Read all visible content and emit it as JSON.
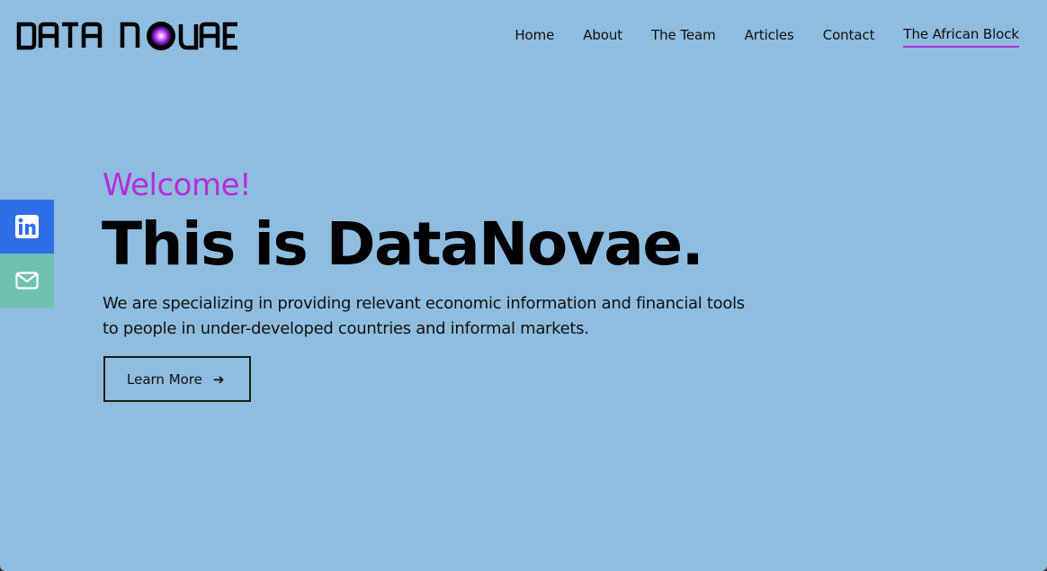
{
  "logo": {
    "text": "DATA NOVAE",
    "accent_color": "#b52ddb"
  },
  "nav": {
    "items": [
      {
        "label": "Home",
        "active": false
      },
      {
        "label": "About",
        "active": false
      },
      {
        "label": "The Team",
        "active": false
      },
      {
        "label": "Articles",
        "active": false
      },
      {
        "label": "Contact",
        "active": false
      },
      {
        "label": "The African Block",
        "active": true
      }
    ]
  },
  "social": {
    "linkedin_icon": "linkedin-icon",
    "mail_icon": "mail-icon"
  },
  "hero": {
    "welcome": "Welcome!",
    "headline": "This is DataNovae.",
    "description": "We are specializing in providing relevant economic information and financial tools to people in under-developed countries and informal markets.",
    "button_label": "Learn More",
    "button_icon": "arrow-right-icon"
  },
  "colors": {
    "background": "#8fbde0",
    "accent": "#b52ddb",
    "linkedin": "#2e6fe8",
    "mail": "#6fc2b0"
  }
}
